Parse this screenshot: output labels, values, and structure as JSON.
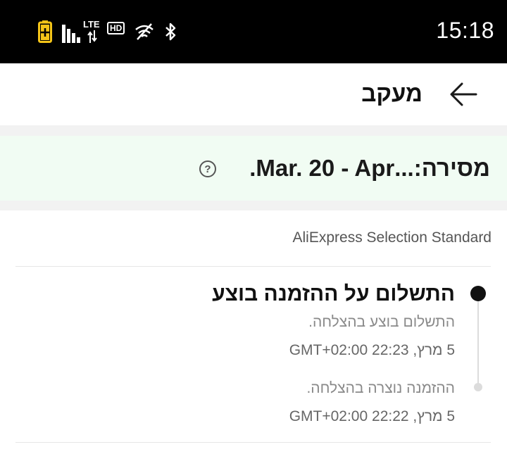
{
  "status_bar": {
    "time": "15:18",
    "network_label": "LTE",
    "hd_label": "HD",
    "icons": [
      "battery-saver-icon",
      "signal-icon",
      "data-arrows-icon",
      "wifi-off-icon",
      "bluetooth-icon"
    ],
    "colors": {
      "background": "#000000",
      "battery": "#f5c518"
    }
  },
  "header": {
    "title": "מעקב",
    "back_icon": "arrow-left-icon"
  },
  "delivery": {
    "text": "מסירה:...Mar. 20 - Apr.",
    "help_icon": "?",
    "background": "#f1fcf3"
  },
  "tracking": {
    "carrier": "AliExpress Selection Standard",
    "events": [
      {
        "title": "התשלום על ההזמנה בוצע",
        "description": "התשלום בוצע בהצלחה.",
        "timestamp": "5 מרץ, 22:23 GMT+02:00",
        "active": true
      },
      {
        "title": "",
        "description": "ההזמנה נוצרה בהצלחה.",
        "timestamp": "5 מרץ, 22:22 GMT+02:00",
        "active": false
      }
    ]
  }
}
